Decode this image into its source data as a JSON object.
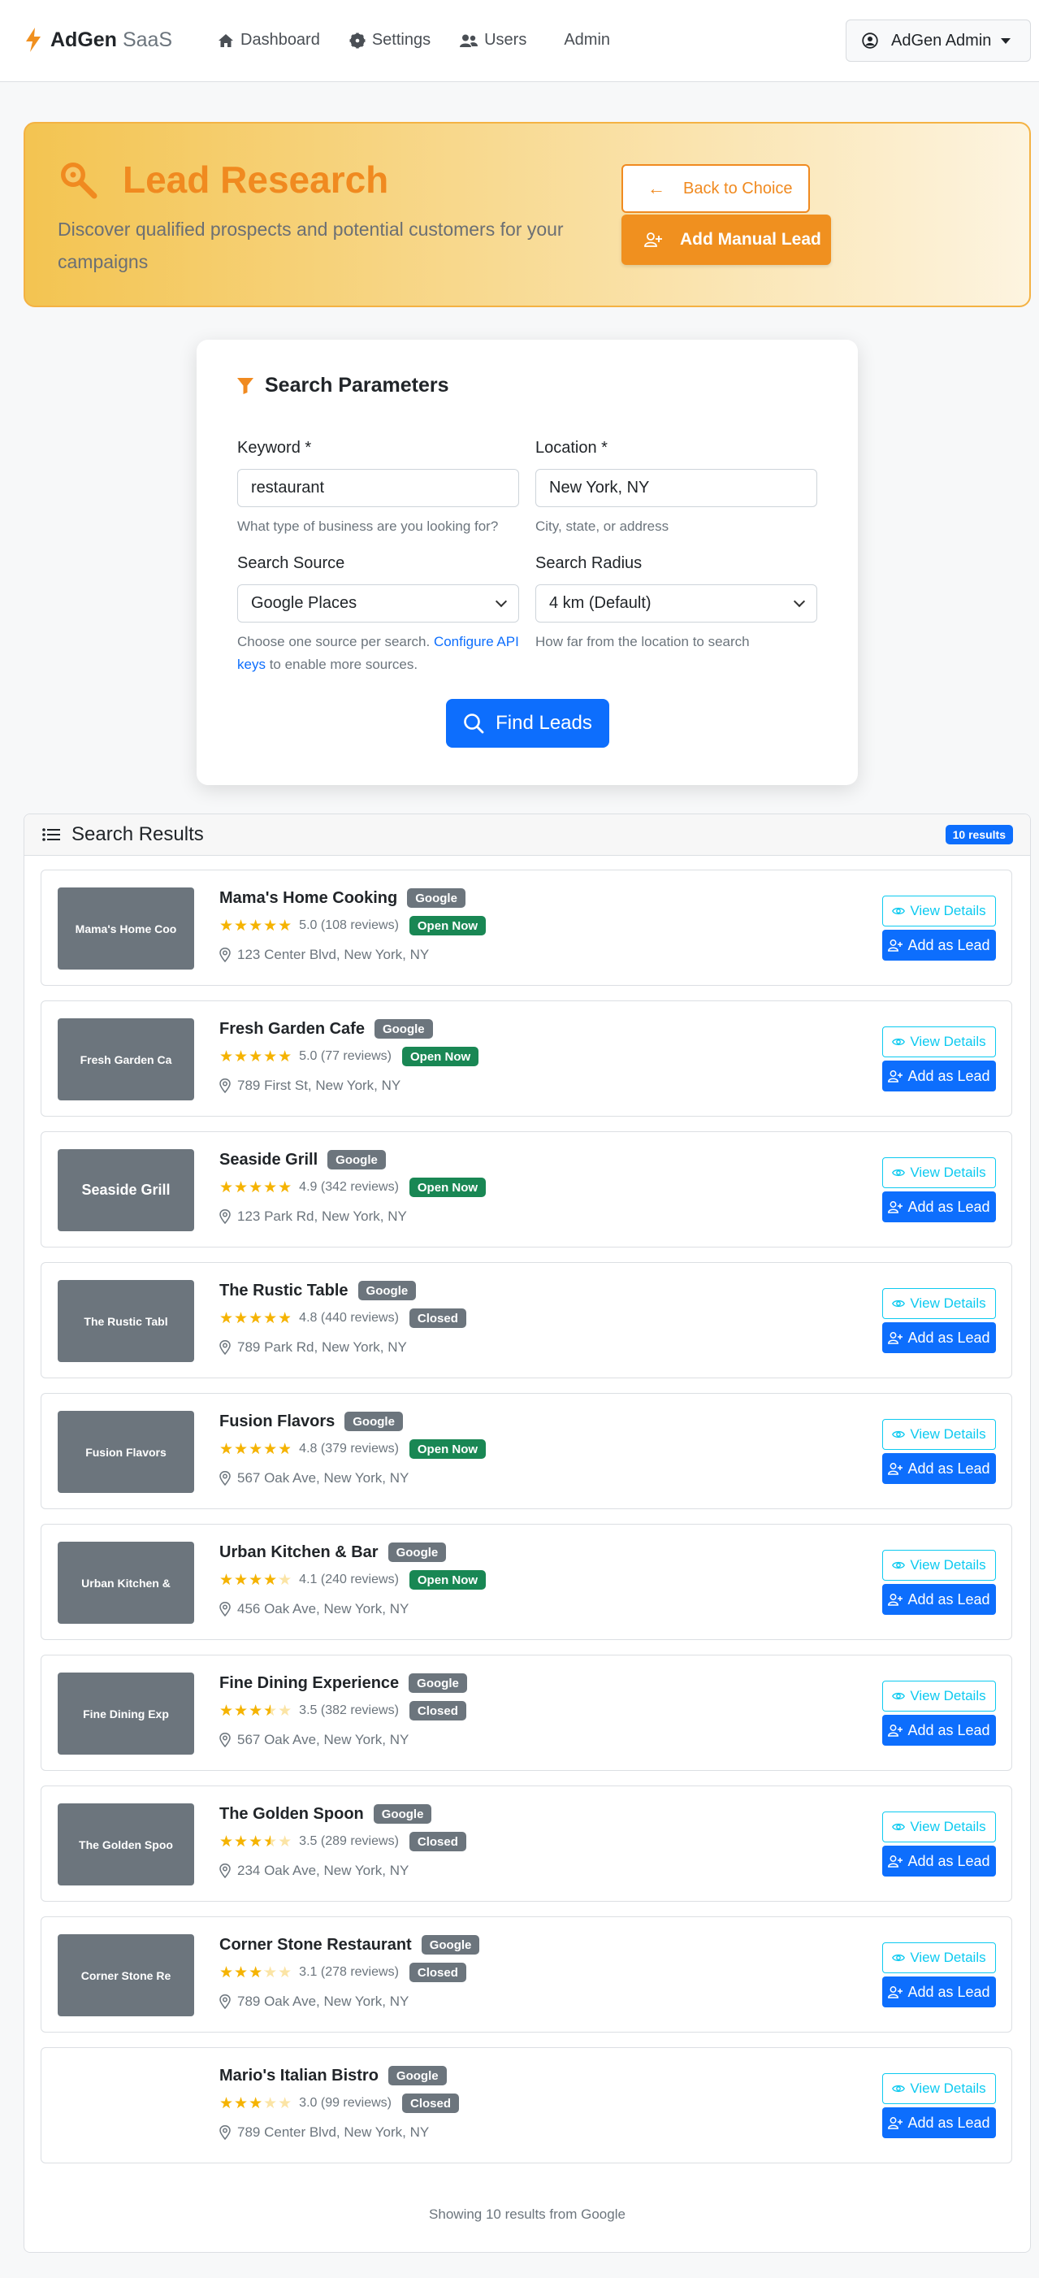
{
  "navbar": {
    "brand_name": "AdGen",
    "brand_suffix": "SaaS",
    "links": [
      {
        "label": "Dashboard",
        "icon": "home-icon"
      },
      {
        "label": "Settings",
        "icon": "gear-icon"
      },
      {
        "label": "Users",
        "icon": "users-icon"
      },
      {
        "label": "Admin",
        "icon": ""
      }
    ],
    "account_label": "AdGen Admin"
  },
  "hero": {
    "title": "Lead Research",
    "subtitle": "Discover qualified prospects and potential customers for your campaigns",
    "back_label": "Back to Choice",
    "add_manual_label": "Add Manual Lead",
    "accent_color": "#f08a20"
  },
  "search": {
    "title": "Search Parameters",
    "keyword_label": "Keyword *",
    "keyword_value": "restaurant",
    "keyword_help": "What type of business are you looking for?",
    "location_label": "Location *",
    "location_value": "New York, NY",
    "location_help": "City, state, or address",
    "source_label": "Search Source",
    "source_value": "Google Places",
    "source_help_prefix": "Choose one source per search.",
    "source_help_link": "Configure API keys",
    "source_help_suffix": "to enable more sources.",
    "radius_label": "Search Radius",
    "radius_value": "4 km (Default)",
    "radius_help": "How far from the location to search",
    "find_label": "Find Leads"
  },
  "results": {
    "title": "Search Results",
    "count_badge": "10 results",
    "view_label": "View Details",
    "add_label": "Add as Lead",
    "footer": "Showing 10 results from Google",
    "items": [
      {
        "thumb": "Mama's Home Coo",
        "name": "Mama's Home Cooking",
        "source": "Google",
        "rating": 5.0,
        "rating_text": "5.0 (108 reviews)",
        "status": "Open Now",
        "open": true,
        "address": "123 Center Blvd, New York, NY"
      },
      {
        "thumb": "Fresh Garden Ca",
        "name": "Fresh Garden Cafe",
        "source": "Google",
        "rating": 5.0,
        "rating_text": "5.0 (77 reviews)",
        "status": "Open Now",
        "open": true,
        "address": "789 First St, New York, NY"
      },
      {
        "thumb": "Seaside Grill",
        "name": "Seaside Grill",
        "source": "Google",
        "rating": 4.9,
        "rating_text": "4.9 (342 reviews)",
        "status": "Open Now",
        "open": true,
        "address": "123 Park Rd, New York, NY"
      },
      {
        "thumb": "The Rustic Tabl",
        "name": "The Rustic Table",
        "source": "Google",
        "rating": 4.8,
        "rating_text": "4.8 (440 reviews)",
        "status": "Closed",
        "open": false,
        "address": "789 Park Rd, New York, NY"
      },
      {
        "thumb": "Fusion Flavors",
        "name": "Fusion Flavors",
        "source": "Google",
        "rating": 4.8,
        "rating_text": "4.8 (379 reviews)",
        "status": "Open Now",
        "open": true,
        "address": "567 Oak Ave, New York, NY"
      },
      {
        "thumb": "Urban Kitchen &",
        "name": "Urban Kitchen & Bar",
        "source": "Google",
        "rating": 4.1,
        "rating_text": "4.1 (240 reviews)",
        "status": "Open Now",
        "open": true,
        "address": "456 Oak Ave, New York, NY"
      },
      {
        "thumb": "Fine Dining Exp",
        "name": "Fine Dining Experience",
        "source": "Google",
        "rating": 3.5,
        "rating_text": "3.5 (382 reviews)",
        "status": "Closed",
        "open": false,
        "address": "567 Oak Ave, New York, NY"
      },
      {
        "thumb": "The Golden Spoo",
        "name": "The Golden Spoon",
        "source": "Google",
        "rating": 3.5,
        "rating_text": "3.5 (289 reviews)",
        "status": "Closed",
        "open": false,
        "address": "234 Oak Ave, New York, NY"
      },
      {
        "thumb": "Corner Stone Re",
        "name": "Corner Stone Restaurant",
        "source": "Google",
        "rating": 3.1,
        "rating_text": "3.1 (278 reviews)",
        "status": "Closed",
        "open": false,
        "address": "789 Oak Ave, New York, NY"
      },
      {
        "thumb": "",
        "name": "Mario's Italian Bistro",
        "source": "Google",
        "rating": 3.0,
        "rating_text": "3.0 (99 reviews)",
        "status": "Closed",
        "open": false,
        "address": "789 Center Blvd, New York, NY"
      }
    ]
  }
}
